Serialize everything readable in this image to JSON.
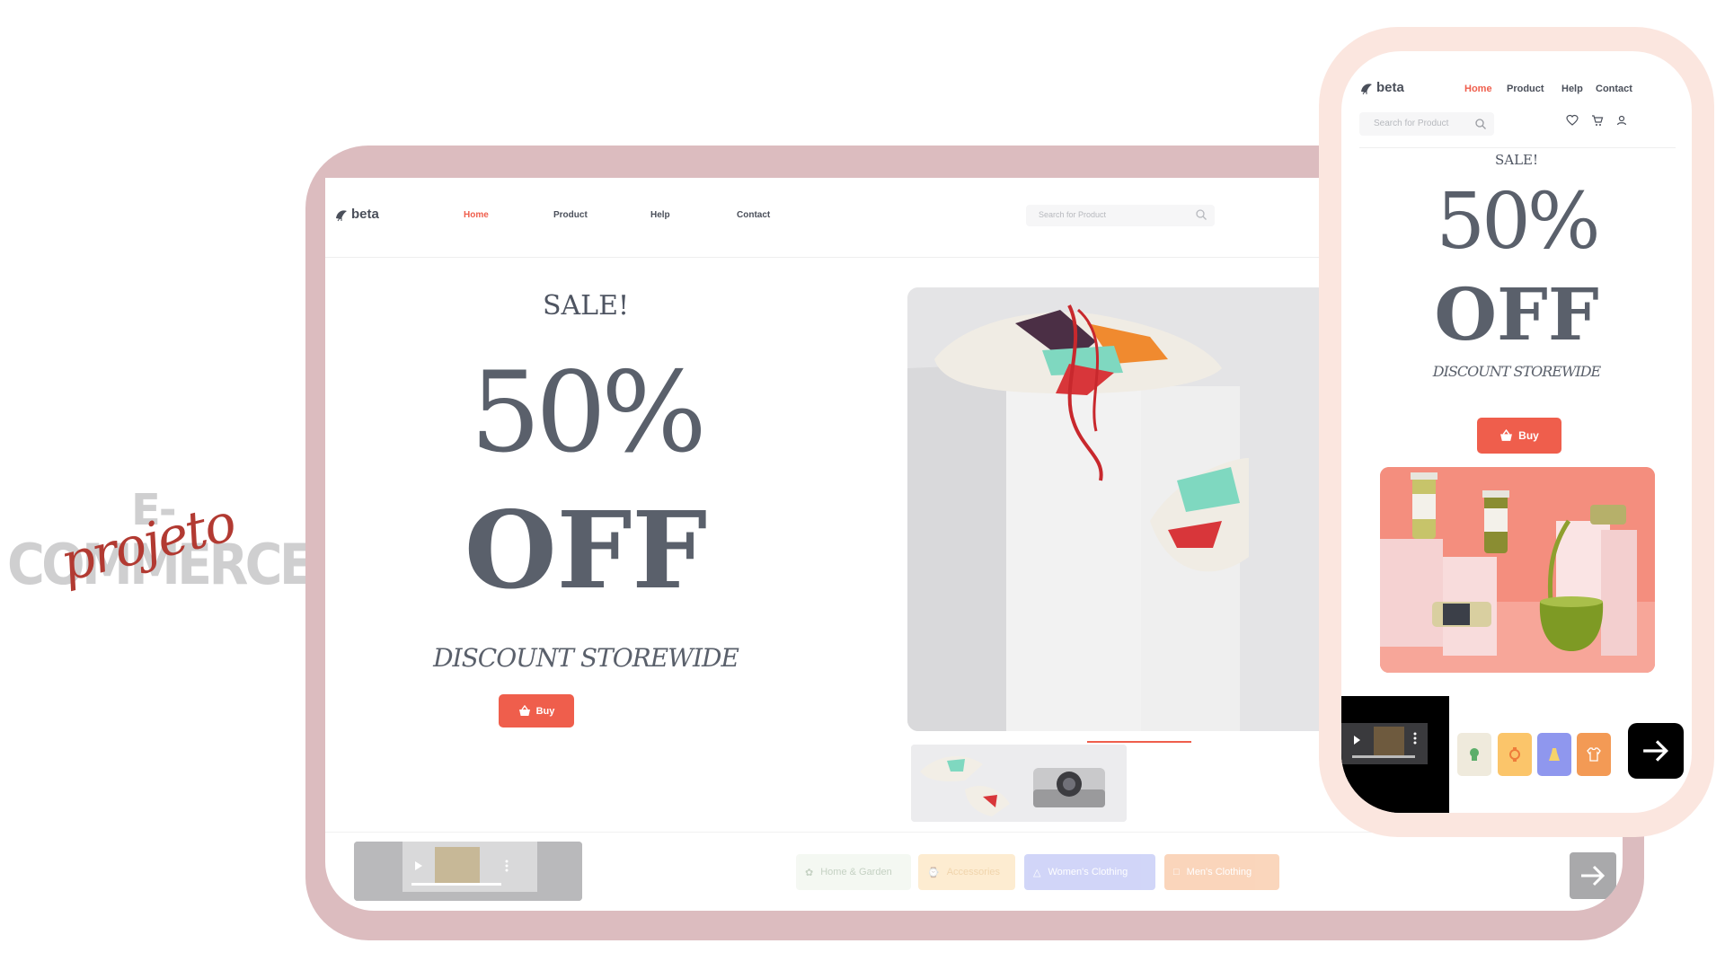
{
  "brand": {
    "line1": "E-",
    "line2": "COMMERCE",
    "script": "projeto"
  },
  "site": {
    "logo": "beta"
  },
  "nav": {
    "home": "Home",
    "product": "Product",
    "help": "Help",
    "contact": "Contact"
  },
  "search": {
    "placeholder": "Search for Product"
  },
  "hero": {
    "sale": "SALE!",
    "percent": "50%",
    "off": "OFF",
    "discount": "DISCOUNT STOREWIDE",
    "buy_label": "Buy"
  },
  "categories": [
    {
      "label": "Home & Garden",
      "color": "#e8f0e4",
      "icon": "plant-icon"
    },
    {
      "label": "Accessories",
      "color": "#fbd79a",
      "icon": "watch-icon"
    },
    {
      "label": "Women's Clothing",
      "color": "#9aa3f0",
      "icon": "dress-icon"
    },
    {
      "label": "Men's Clothing",
      "color": "#f5a36a",
      "icon": "shirt-icon"
    }
  ],
  "colors": {
    "accent": "#ef5e4c",
    "tablet_frame": "#dcbcbf",
    "phone_frame": "#fbe6df"
  }
}
